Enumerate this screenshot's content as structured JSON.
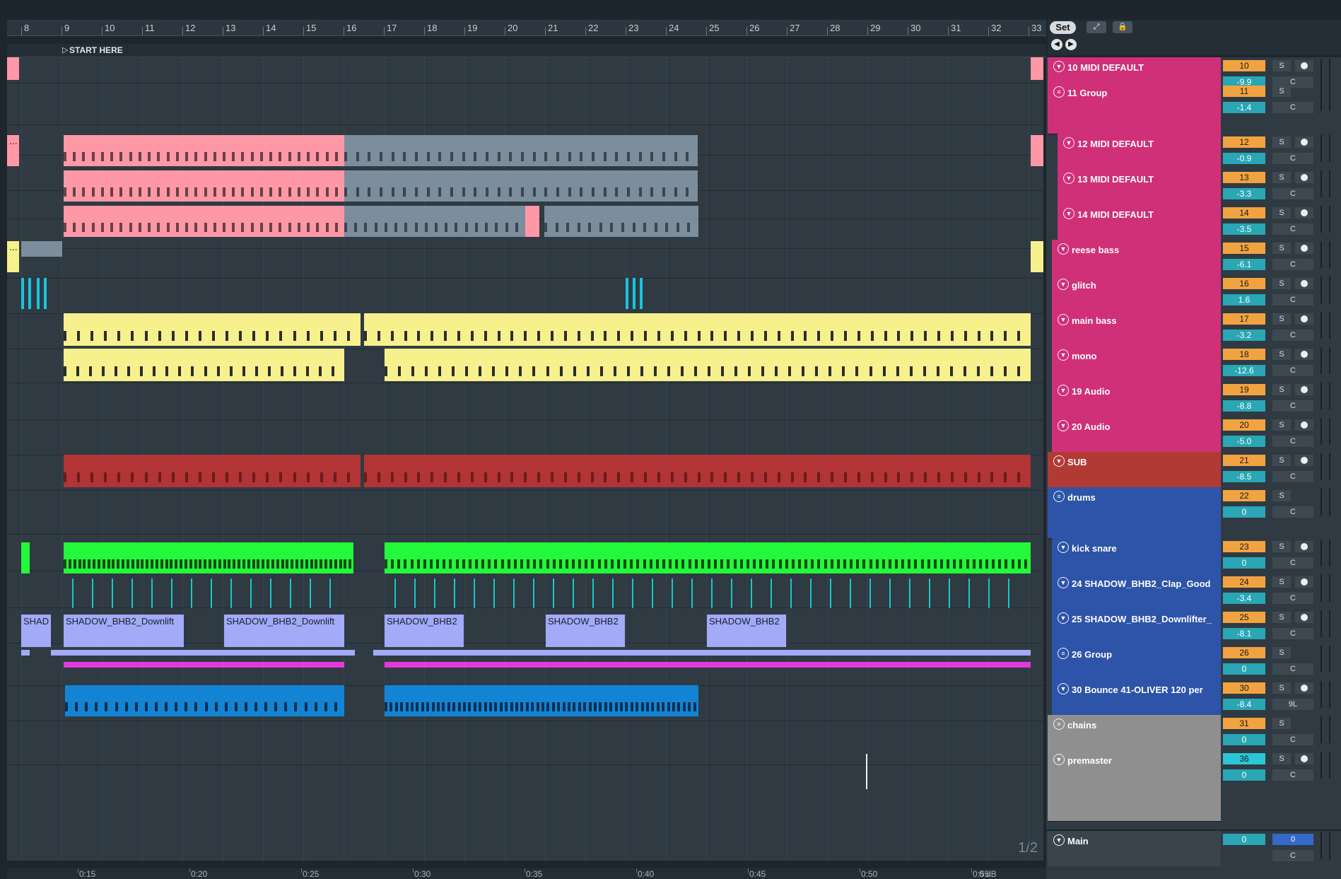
{
  "bars": [
    "8",
    "9",
    "10",
    "11",
    "12",
    "13",
    "14",
    "15",
    "16",
    "17",
    "18",
    "19",
    "20",
    "21",
    "22",
    "23",
    "24",
    "25",
    "26",
    "27",
    "28",
    "29",
    "30",
    "31",
    "32",
    "33"
  ],
  "locator": "START HERE",
  "timeline": [
    "0:15",
    "0:20",
    "0:25",
    "0:30",
    "0:35",
    "0:40",
    "0:45",
    "0:50",
    "0:55"
  ],
  "timeline_extra": "0 dB",
  "page_indicator": "1/2",
  "topbar": {
    "set_label": "Set",
    "expand_icon": "expand-icon",
    "lock_icon": "lock-icon",
    "prev_icon": "left-arrow-icon",
    "next_icon": "right-arrow-icon"
  },
  "tracks": [
    {
      "name": "10 MIDI DEFAULT",
      "num": "10",
      "vol": "-9.9",
      "pan": "C",
      "color": "#d03078"
    },
    {
      "name": "11 Group",
      "num": "11",
      "vol": "-1.4",
      "pan": "C",
      "color": "#d03078"
    },
    {
      "name": "12 MIDI DEFAULT",
      "num": "12",
      "vol": "-0.9",
      "pan": "C",
      "color": "#d03078"
    },
    {
      "name": "13 MIDI DEFAULT",
      "num": "13",
      "vol": "-3.3",
      "pan": "C",
      "color": "#d03078"
    },
    {
      "name": "14 MIDI DEFAULT",
      "num": "14",
      "vol": "-3.5",
      "pan": "C",
      "color": "#d03078"
    },
    {
      "name": "reese bass",
      "num": "15",
      "vol": "-6.1",
      "pan": "C",
      "color": "#d03078"
    },
    {
      "name": "glitch",
      "num": "16",
      "vol": "1.6",
      "pan": "C",
      "color": "#d03078"
    },
    {
      "name": "main bass",
      "num": "17",
      "vol": "-3.2",
      "pan": "C",
      "color": "#d03078"
    },
    {
      "name": "mono",
      "num": "18",
      "vol": "-12.6",
      "pan": "C",
      "color": "#d03078"
    },
    {
      "name": "19 Audio",
      "num": "19",
      "vol": "-8.8",
      "pan": "C",
      "color": "#d03078"
    },
    {
      "name": "20 Audio",
      "num": "20",
      "vol": "-5.0",
      "pan": "C",
      "color": "#d03078"
    },
    {
      "name": "SUB",
      "num": "21",
      "vol": "-8.5",
      "pan": "C",
      "color": "#b23a35"
    },
    {
      "name": "drums",
      "num": "22",
      "vol": "0",
      "pan": "C",
      "color": "#2d54a8"
    },
    {
      "name": "kick snare",
      "num": "23",
      "vol": "0",
      "pan": "C",
      "color": "#2d54a8"
    },
    {
      "name": "24 SHADOW_BHB2_Clap_Good",
      "num": "24",
      "vol": "-3.4",
      "pan": "C",
      "color": "#2d54a8"
    },
    {
      "name": "25 SHADOW_BHB2_Downlifter_",
      "num": "25",
      "vol": "-8.1",
      "pan": "C",
      "color": "#2d54a8"
    },
    {
      "name": "26 Group",
      "num": "26",
      "vol": "0",
      "pan": "C",
      "color": "#2d54a8"
    },
    {
      "name": "30 Bounce 41-OLIVER  120  per",
      "num": "30",
      "vol": "-8.4",
      "pan": "9L",
      "color": "#2d54a8"
    },
    {
      "name": "chains",
      "num": "31",
      "vol": "0",
      "pan": "C",
      "color": "#8f8f8f"
    },
    {
      "name": "premaster",
      "num": "36",
      "vol": "0",
      "pan": "C",
      "color": "#8f8f8f"
    }
  ],
  "main_track": {
    "name": "Main",
    "vol": "0",
    "pan": "C",
    "send": "0"
  },
  "clips": {
    "audio_label_1": "SHADOW_BHB2_Downlift",
    "audio_label_2": "SHADOW_BHB2_Downlift",
    "audio_label_3": "SHADOW_BHB2",
    "audio_label_4": "SHADOW_BHB2",
    "audio_label_5": "SHADOW_BHB2",
    "audio_label_short": "SHAD",
    "dots": "..."
  },
  "colors": {
    "pink": "#ff98a6",
    "gray_clip": "#7c8d9c",
    "yellow": "#f6f18c",
    "red": "#b23434",
    "green": "#23f83a",
    "lavender": "#a3aaf7",
    "magenta": "#e23ad9",
    "blue_clip": "#1384d4"
  }
}
